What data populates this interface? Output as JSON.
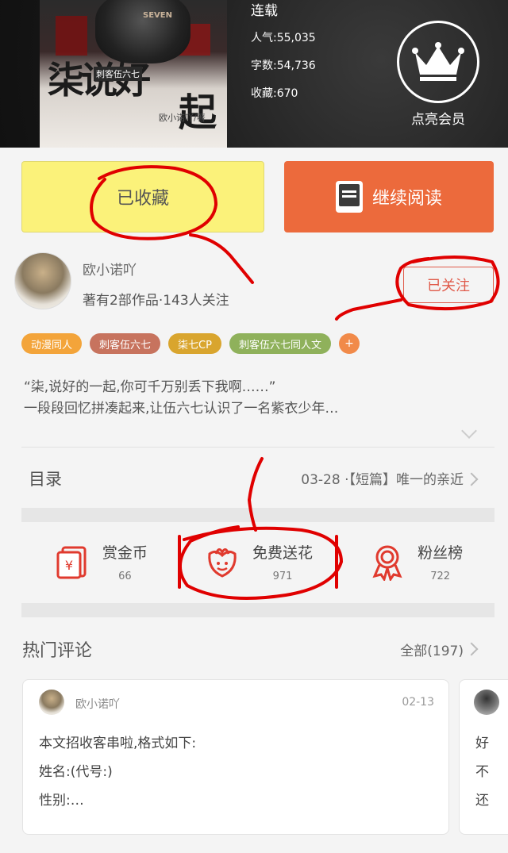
{
  "book": {
    "cover": {
      "title_main": "柒说好",
      "title_end": "起",
      "series_tag": "刺客伍六七",
      "author_credit": "欧小诺吖/著",
      "badge": "SEVEN"
    },
    "status": "连载",
    "popularity": "人气:55,035",
    "word_count": "字数:54,736",
    "favorites": "收藏:670",
    "vip_label": "点亮会员"
  },
  "actions": {
    "collected_label": "已收藏",
    "continue_label": "继续阅读"
  },
  "author": {
    "name": "欧小诺吖",
    "info": "著有2部作品·143人关注",
    "follow_label": "已关注"
  },
  "tags": [
    {
      "label": "动漫同人",
      "color": "#f3a43a"
    },
    {
      "label": "刺客伍六七",
      "color": "#c7735e"
    },
    {
      "label": "柒七CP",
      "color": "#d9a52e"
    },
    {
      "label": "刺客伍六七同人文",
      "color": "#8fb15b"
    }
  ],
  "tag_add": "+",
  "intro": {
    "line1": "“柒,说好的一起,你可千万别丢下我啊……”",
    "line2": "一段段回忆拼凑起来,让伍六七认识了一名紫衣少年…"
  },
  "toc": {
    "label": "目录",
    "latest": "03-28 ·【短篇】唯一的亲近"
  },
  "rewards": [
    {
      "title": "赏金币",
      "count": "66",
      "icon": "red-envelope-icon"
    },
    {
      "title": "免费送花",
      "count": "971",
      "icon": "flower-icon"
    },
    {
      "title": "粉丝榜",
      "count": "722",
      "icon": "medal-icon"
    }
  ],
  "hot_comments": {
    "title": "热门评论",
    "all_label": "全部(197)",
    "items": [
      {
        "user": "欧小诺吖",
        "date": "02-13",
        "lines": [
          "本文招收客串啦,格式如下:",
          "姓名:(代号:)",
          "性别:…"
        ]
      },
      {
        "lines": [
          "好",
          "不",
          "还"
        ]
      }
    ]
  },
  "colors": {
    "collected_bg": "#fbf27a",
    "continue_bg": "#ec6a3c",
    "follow": "#e05a4a",
    "annotation": "#e00000"
  }
}
